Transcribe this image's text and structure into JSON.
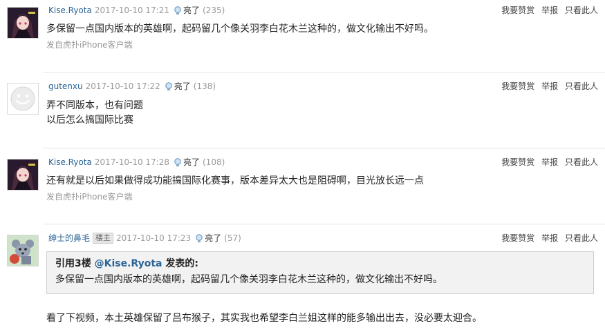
{
  "actions": {
    "reward": "我要赞赏",
    "report": "举报",
    "only_this": "只看此人"
  },
  "like_label": "亮了",
  "posts": [
    {
      "username": "Kise.Ryota",
      "time": "2017-10-10 17:21",
      "likes": "(235)",
      "content": [
        "多保留一点国内版本的英雄啊，起码留几个像关羽李白花木兰这种的，做文化输出不好吗。"
      ],
      "source": "发自虎扑iPhone客户端",
      "avatar": "anime-girl-avatar"
    },
    {
      "username": "gutenxu",
      "time": "2017-10-10 17:22",
      "likes": "(138)",
      "content": [
        "弄不同版本，也有问题",
        "以后怎么搞国际比赛"
      ],
      "avatar": "default-smiley-avatar"
    },
    {
      "username": "Kise.Ryota",
      "time": "2017-10-10 17:28",
      "likes": "(108)",
      "content": [
        "还有就是以后如果做得成功能搞国际化赛事，版本差异太大也是阻碍啊，目光放长远一点"
      ],
      "source": "发自虎扑iPhone客户端",
      "avatar": "anime-girl-avatar"
    },
    {
      "username": "绅士的鼻毛",
      "badge": "楼主",
      "time": "2017-10-10 17:23",
      "likes": "(57)",
      "quote": {
        "prefix": "引用3楼 ",
        "user": "@Kise.Ryota",
        "suffix": " 发表的:",
        "body": "多保留一点国内版本的英雄啊，起码留几个像关羽李白花木兰这种的，做文化输出不好吗。"
      },
      "content": [
        "看了下视频，本土英雄保留了吕布猴子，其实我也希望李白兰姐这样的能多输出出去，没必要太迎合。"
      ],
      "avatar": "cartoon-mouse-avatar"
    }
  ],
  "colors": {
    "link": "#2a6496",
    "muted": "#999999",
    "quote_bg": "#f2f2f2"
  }
}
